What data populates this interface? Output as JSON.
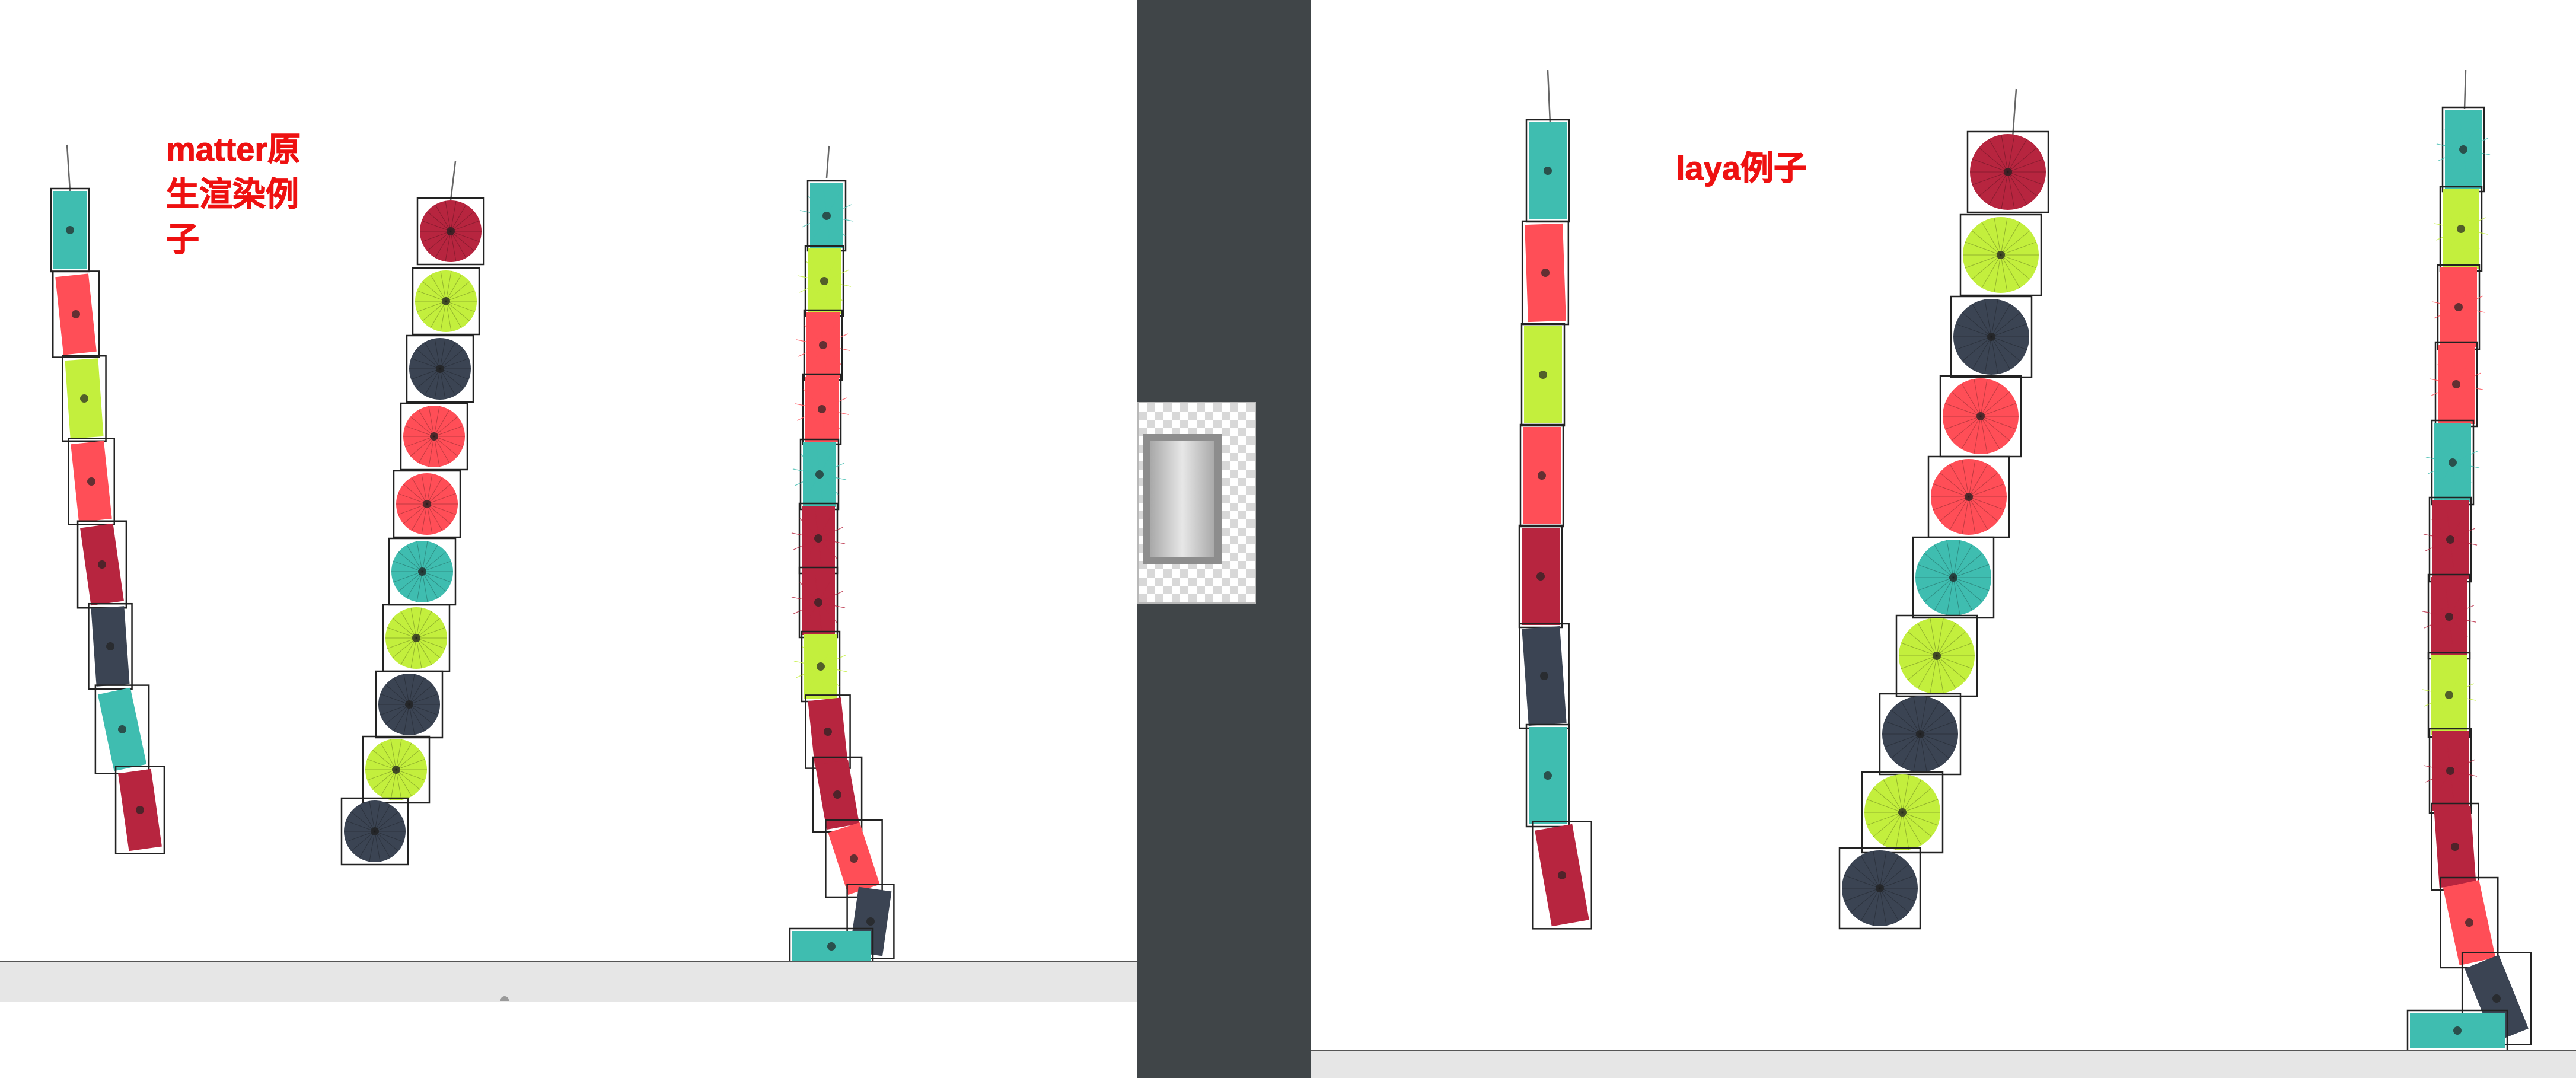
{
  "left_panel": {
    "title": "matter原生渲染例子",
    "title_lines": [
      "matter原",
      "生渲染例",
      "子"
    ]
  },
  "right_panel": {
    "title": "laya例子"
  },
  "colors": {
    "teal": "#3fbdb0",
    "red": "#ff4e57",
    "dark_red": "#b7253f",
    "lime": "#c3ef3d",
    "navy": "#3b4453",
    "divider": "#404548",
    "caption": "#ee1111",
    "ground": "#e6e6e6"
  },
  "scenes": {
    "left_chain_1": [
      "teal",
      "red",
      "lime",
      "red",
      "dark_red",
      "navy",
      "teal",
      "dark_red"
    ],
    "left_chain_2": [
      "dark_red",
      "lime",
      "navy",
      "red",
      "red",
      "teal",
      "lime",
      "navy",
      "lime",
      "navy"
    ],
    "left_chain_3": [
      "teal",
      "lime",
      "red",
      "red",
      "teal",
      "dark_red",
      "dark_red",
      "lime",
      "dark_red",
      "dark_red",
      "red",
      "navy",
      "teal"
    ],
    "right_chain_1": [
      "teal",
      "red",
      "lime",
      "red",
      "dark_red",
      "navy",
      "teal",
      "dark_red"
    ],
    "right_chain_2": [
      "dark_red",
      "lime",
      "navy",
      "red",
      "red",
      "teal",
      "lime",
      "navy",
      "lime",
      "navy"
    ],
    "right_chain_3": [
      "teal",
      "lime",
      "red",
      "red",
      "teal",
      "dark_red",
      "dark_red",
      "lime",
      "dark_red",
      "dark_red",
      "red",
      "navy",
      "teal"
    ]
  }
}
